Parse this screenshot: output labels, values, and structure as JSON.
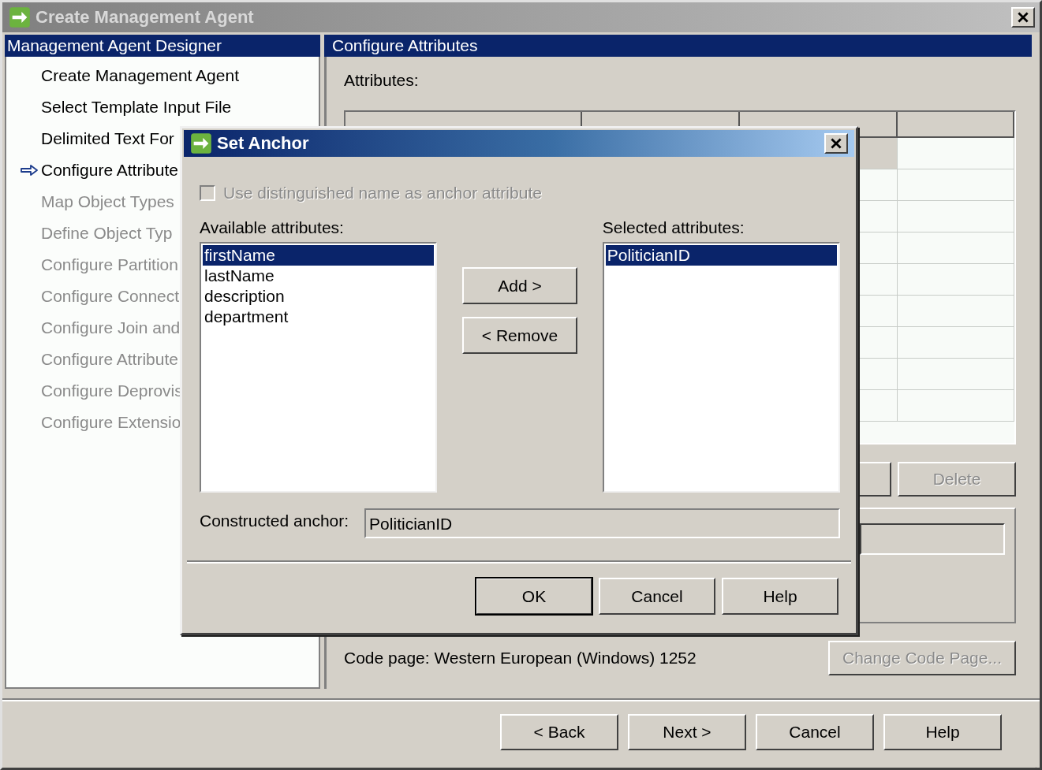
{
  "window": {
    "title": "Create Management Agent",
    "active": false
  },
  "sidebar": {
    "header": "Management Agent Designer",
    "items": [
      {
        "label": "Create Management Agent",
        "current": false,
        "disabled": false
      },
      {
        "label": "Select Template Input File",
        "current": false,
        "disabled": false
      },
      {
        "label": "Delimited Text For",
        "current": false,
        "disabled": false
      },
      {
        "label": "Configure Attribute",
        "current": true,
        "disabled": false
      },
      {
        "label": "Map Object Types",
        "current": false,
        "disabled": true
      },
      {
        "label": "Define Object Typ",
        "current": false,
        "disabled": true
      },
      {
        "label": "Configure Partition",
        "current": false,
        "disabled": true
      },
      {
        "label": "Configure Connect",
        "current": false,
        "disabled": true
      },
      {
        "label": "Configure Join and",
        "current": false,
        "disabled": true
      },
      {
        "label": "Configure Attribute",
        "current": false,
        "disabled": true
      },
      {
        "label": "Configure Deprovis",
        "current": false,
        "disabled": true
      },
      {
        "label": "Configure Extensio",
        "current": false,
        "disabled": true
      }
    ]
  },
  "panel": {
    "header": "Configure Attributes",
    "attributes_label": "Attributes:",
    "delete_button": {
      "label": "Delete",
      "disabled": true
    },
    "code_page": "Code page: Western European (Windows) 1252",
    "change_code_page": {
      "label": "Change Code Page...",
      "disabled": true
    }
  },
  "dialog": {
    "title": "Set Anchor",
    "use_dn": {
      "label": "Use distinguished name as anchor attribute",
      "checked": false,
      "disabled": true
    },
    "available_label": "Available attributes:",
    "available": [
      {
        "label": "firstName",
        "selected": true
      },
      {
        "label": "lastName",
        "selected": false
      },
      {
        "label": "description",
        "selected": false
      },
      {
        "label": "department",
        "selected": false
      }
    ],
    "add": "Add >",
    "remove": "< Remove",
    "selected_label": "Selected attributes:",
    "selected": [
      {
        "label": "PoliticianID",
        "selected": true
      }
    ],
    "anchor_label": "Constructed anchor:",
    "anchor_value": "PoliticianID",
    "buttons": [
      {
        "label": "OK",
        "default": true
      },
      {
        "label": "Cancel",
        "default": false
      },
      {
        "label": "Help",
        "default": false
      }
    ]
  },
  "footer_buttons": [
    "< Back",
    "Next >",
    "Cancel",
    "Help"
  ]
}
